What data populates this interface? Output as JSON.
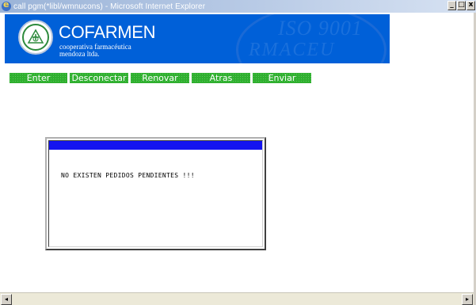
{
  "window": {
    "title": "call pgm(*libl/wmnucons) - Microsoft Internet Explorer",
    "minimize": "_",
    "maximize": "□",
    "close": "x"
  },
  "banner": {
    "brand": "COFARMEN",
    "subtitle_line1": "cooperativa farmacéutica",
    "subtitle_line2": "mendoza ltda.",
    "iso_mark": "ISO 9001",
    "watermark_text": "RMACEU"
  },
  "menu": {
    "items": [
      "Enter",
      "Desconectar",
      "Renovar",
      "Atras",
      "Enviar"
    ]
  },
  "dialog": {
    "message": "NO EXISTEN PEDIDOS PENDIENTES !!!"
  },
  "scrollbar": {
    "left_arrow": "◂",
    "right_arrow": "▸"
  },
  "colors": {
    "banner_bg": "#0060d8",
    "menu_button": "#2faf2f",
    "dialog_header": "#1414f0"
  }
}
